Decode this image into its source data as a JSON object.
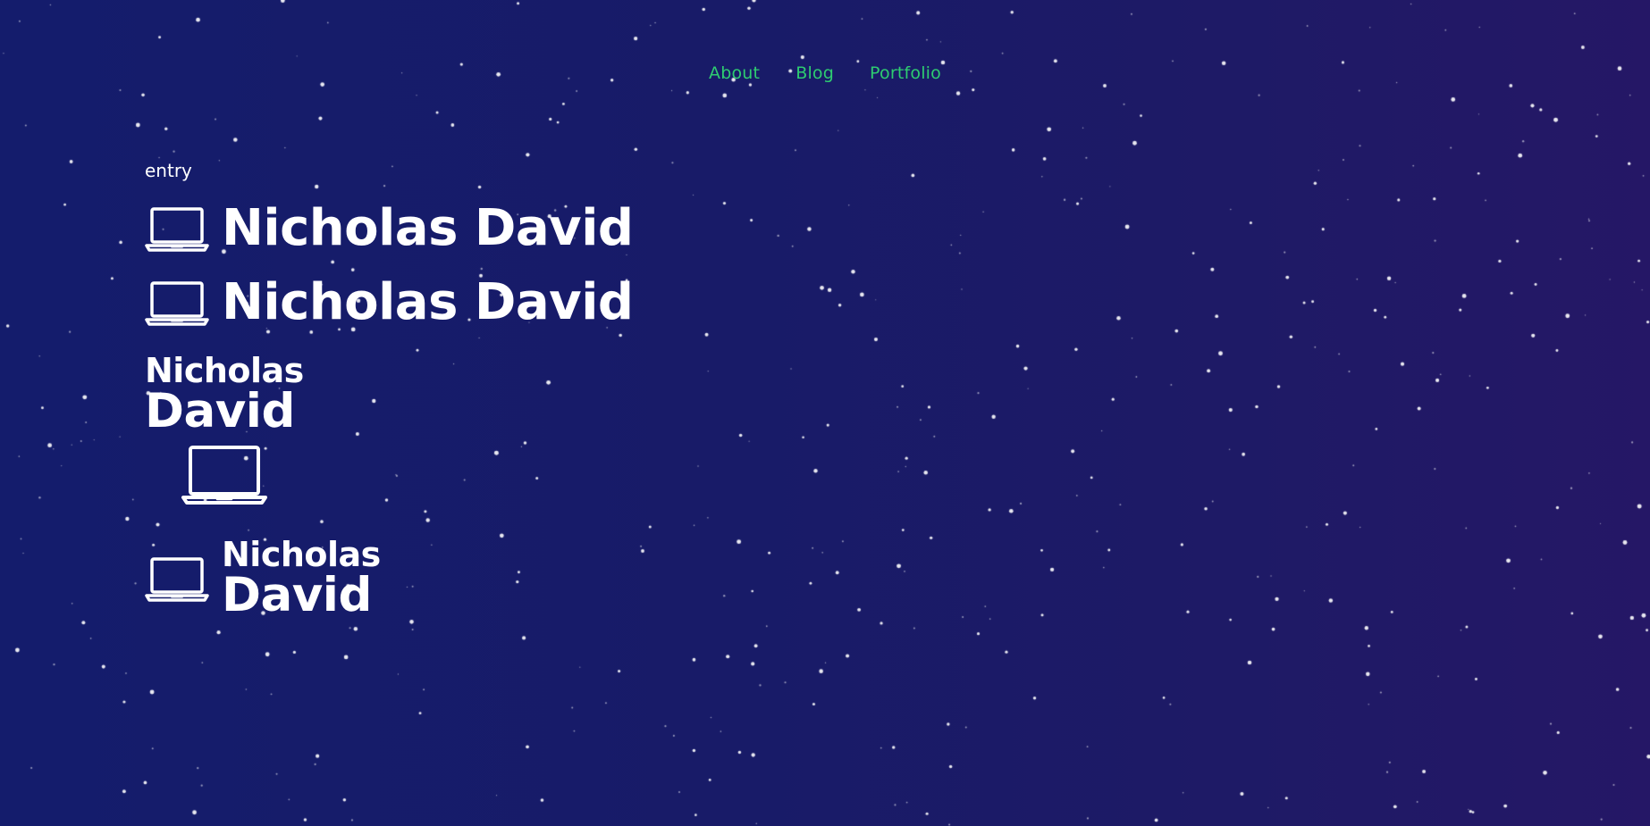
{
  "nav": {
    "items": [
      {
        "label": "About"
      },
      {
        "label": "Blog"
      },
      {
        "label": "Portfolio"
      }
    ]
  },
  "main": {
    "entry_label": "entry",
    "logos": {
      "inline_1": {
        "name": "Nicholas David",
        "icon": "laptop-icon"
      },
      "inline_2": {
        "name": "Nicholas David",
        "icon": "laptop-icon"
      },
      "stacked": {
        "first": "Nicholas",
        "last": "David",
        "icon": "laptop-icon"
      },
      "side_stacked": {
        "first": "Nicholas",
        "last": "David",
        "icon": "laptop-icon"
      }
    }
  },
  "colors": {
    "background_start": "#141c6c",
    "background_end": "#251766",
    "nav_link": "#2ecc71",
    "text": "#ffffff"
  }
}
